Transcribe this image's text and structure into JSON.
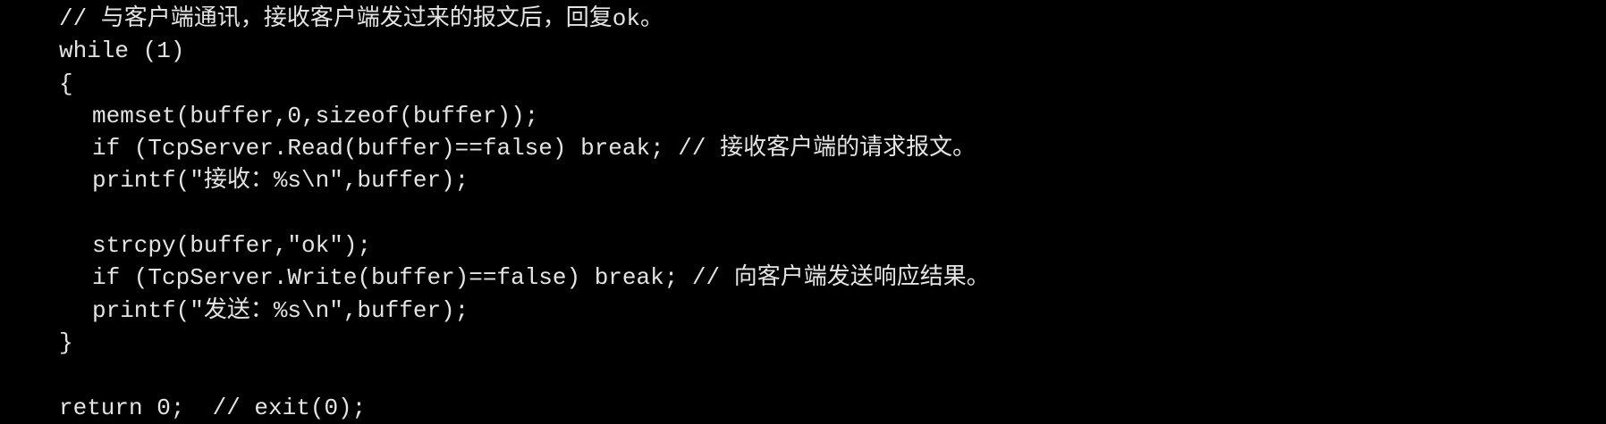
{
  "code": {
    "lines": [
      {
        "text": "// 与客户端通讯，接收客户端发过来的报文后，回复ok。"
      },
      {
        "text": "while (1)"
      },
      {
        "text": "{"
      },
      {
        "text": "memset(buffer,0,sizeof(buffer));"
      },
      {
        "text": "if (TcpServer.Read(buffer)==false) break; // 接收客户端的请求报文。"
      },
      {
        "text": "printf(\"接收：%s\\n\",buffer);"
      },
      {
        "text": ""
      },
      {
        "text": "strcpy(buffer,\"ok\");"
      },
      {
        "text": "if (TcpServer.Write(buffer)==false) break; // 向客户端发送响应结果。"
      },
      {
        "text": "printf(\"发送：%s\\n\",buffer);"
      },
      {
        "text": "}"
      },
      {
        "text": ""
      },
      {
        "text": "return 0;  // exit(0);"
      }
    ]
  }
}
